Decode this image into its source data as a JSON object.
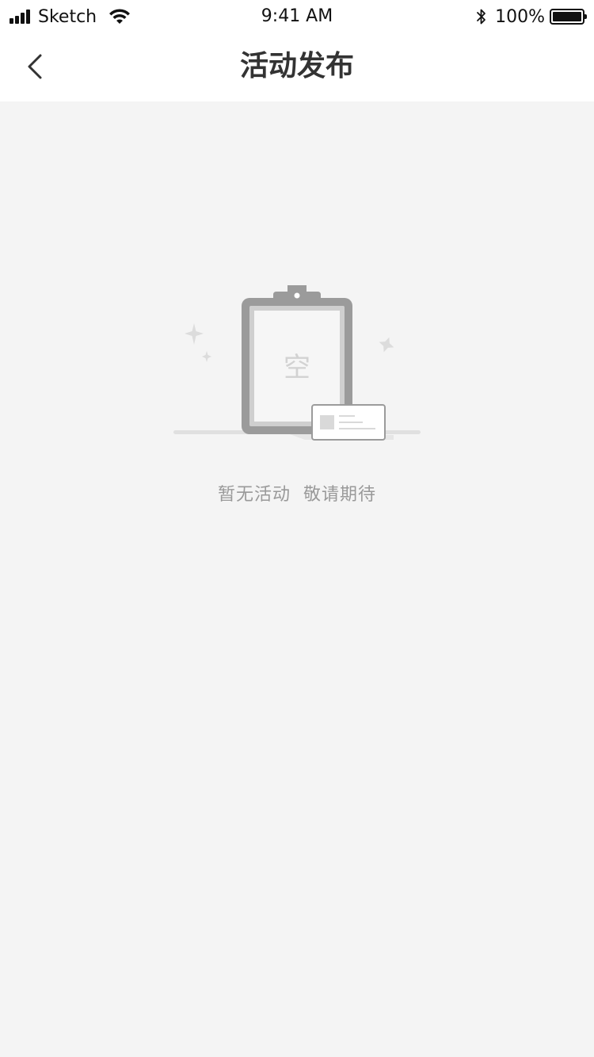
{
  "status_bar": {
    "carrier": "Sketch",
    "time": "9:41 AM",
    "battery_percent": "100%",
    "icons": [
      "signal-icon",
      "wifi-icon",
      "bluetooth-icon",
      "battery-icon"
    ]
  },
  "nav": {
    "title": "活动发布",
    "back_icon": "chevron-left-icon"
  },
  "empty_state": {
    "illustration": "clipboard-empty-icon",
    "glyph": "空",
    "message": "暂无活动  敬请期待"
  },
  "colors": {
    "background": "#f4f4f4",
    "bar_background": "#ffffff",
    "title": "#333333",
    "muted_text": "#999999",
    "illustration_gray": "#9b9b9b"
  }
}
